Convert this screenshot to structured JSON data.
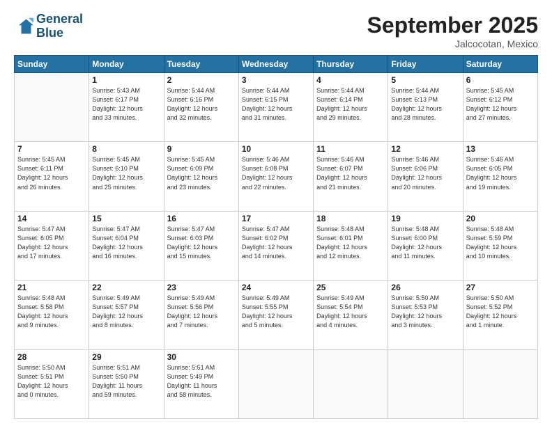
{
  "logo": {
    "line1": "General",
    "line2": "Blue"
  },
  "title": "September 2025",
  "location": "Jalcocotan, Mexico",
  "days_header": [
    "Sunday",
    "Monday",
    "Tuesday",
    "Wednesday",
    "Thursday",
    "Friday",
    "Saturday"
  ],
  "weeks": [
    [
      {
        "day": "",
        "info": ""
      },
      {
        "day": "1",
        "info": "Sunrise: 5:43 AM\nSunset: 6:17 PM\nDaylight: 12 hours\nand 33 minutes."
      },
      {
        "day": "2",
        "info": "Sunrise: 5:44 AM\nSunset: 6:16 PM\nDaylight: 12 hours\nand 32 minutes."
      },
      {
        "day": "3",
        "info": "Sunrise: 5:44 AM\nSunset: 6:15 PM\nDaylight: 12 hours\nand 31 minutes."
      },
      {
        "day": "4",
        "info": "Sunrise: 5:44 AM\nSunset: 6:14 PM\nDaylight: 12 hours\nand 29 minutes."
      },
      {
        "day": "5",
        "info": "Sunrise: 5:44 AM\nSunset: 6:13 PM\nDaylight: 12 hours\nand 28 minutes."
      },
      {
        "day": "6",
        "info": "Sunrise: 5:45 AM\nSunset: 6:12 PM\nDaylight: 12 hours\nand 27 minutes."
      }
    ],
    [
      {
        "day": "7",
        "info": "Sunrise: 5:45 AM\nSunset: 6:11 PM\nDaylight: 12 hours\nand 26 minutes."
      },
      {
        "day": "8",
        "info": "Sunrise: 5:45 AM\nSunset: 6:10 PM\nDaylight: 12 hours\nand 25 minutes."
      },
      {
        "day": "9",
        "info": "Sunrise: 5:45 AM\nSunset: 6:09 PM\nDaylight: 12 hours\nand 23 minutes."
      },
      {
        "day": "10",
        "info": "Sunrise: 5:46 AM\nSunset: 6:08 PM\nDaylight: 12 hours\nand 22 minutes."
      },
      {
        "day": "11",
        "info": "Sunrise: 5:46 AM\nSunset: 6:07 PM\nDaylight: 12 hours\nand 21 minutes."
      },
      {
        "day": "12",
        "info": "Sunrise: 5:46 AM\nSunset: 6:06 PM\nDaylight: 12 hours\nand 20 minutes."
      },
      {
        "day": "13",
        "info": "Sunrise: 5:46 AM\nSunset: 6:05 PM\nDaylight: 12 hours\nand 19 minutes."
      }
    ],
    [
      {
        "day": "14",
        "info": "Sunrise: 5:47 AM\nSunset: 6:05 PM\nDaylight: 12 hours\nand 17 minutes."
      },
      {
        "day": "15",
        "info": "Sunrise: 5:47 AM\nSunset: 6:04 PM\nDaylight: 12 hours\nand 16 minutes."
      },
      {
        "day": "16",
        "info": "Sunrise: 5:47 AM\nSunset: 6:03 PM\nDaylight: 12 hours\nand 15 minutes."
      },
      {
        "day": "17",
        "info": "Sunrise: 5:47 AM\nSunset: 6:02 PM\nDaylight: 12 hours\nand 14 minutes."
      },
      {
        "day": "18",
        "info": "Sunrise: 5:48 AM\nSunset: 6:01 PM\nDaylight: 12 hours\nand 12 minutes."
      },
      {
        "day": "19",
        "info": "Sunrise: 5:48 AM\nSunset: 6:00 PM\nDaylight: 12 hours\nand 11 minutes."
      },
      {
        "day": "20",
        "info": "Sunrise: 5:48 AM\nSunset: 5:59 PM\nDaylight: 12 hours\nand 10 minutes."
      }
    ],
    [
      {
        "day": "21",
        "info": "Sunrise: 5:48 AM\nSunset: 5:58 PM\nDaylight: 12 hours\nand 9 minutes."
      },
      {
        "day": "22",
        "info": "Sunrise: 5:49 AM\nSunset: 5:57 PM\nDaylight: 12 hours\nand 8 minutes."
      },
      {
        "day": "23",
        "info": "Sunrise: 5:49 AM\nSunset: 5:56 PM\nDaylight: 12 hours\nand 7 minutes."
      },
      {
        "day": "24",
        "info": "Sunrise: 5:49 AM\nSunset: 5:55 PM\nDaylight: 12 hours\nand 5 minutes."
      },
      {
        "day": "25",
        "info": "Sunrise: 5:49 AM\nSunset: 5:54 PM\nDaylight: 12 hours\nand 4 minutes."
      },
      {
        "day": "26",
        "info": "Sunrise: 5:50 AM\nSunset: 5:53 PM\nDaylight: 12 hours\nand 3 minutes."
      },
      {
        "day": "27",
        "info": "Sunrise: 5:50 AM\nSunset: 5:52 PM\nDaylight: 12 hours\nand 1 minute."
      }
    ],
    [
      {
        "day": "28",
        "info": "Sunrise: 5:50 AM\nSunset: 5:51 PM\nDaylight: 12 hours\nand 0 minutes."
      },
      {
        "day": "29",
        "info": "Sunrise: 5:51 AM\nSunset: 5:50 PM\nDaylight: 11 hours\nand 59 minutes."
      },
      {
        "day": "30",
        "info": "Sunrise: 5:51 AM\nSunset: 5:49 PM\nDaylight: 11 hours\nand 58 minutes."
      },
      {
        "day": "",
        "info": ""
      },
      {
        "day": "",
        "info": ""
      },
      {
        "day": "",
        "info": ""
      },
      {
        "day": "",
        "info": ""
      }
    ]
  ]
}
